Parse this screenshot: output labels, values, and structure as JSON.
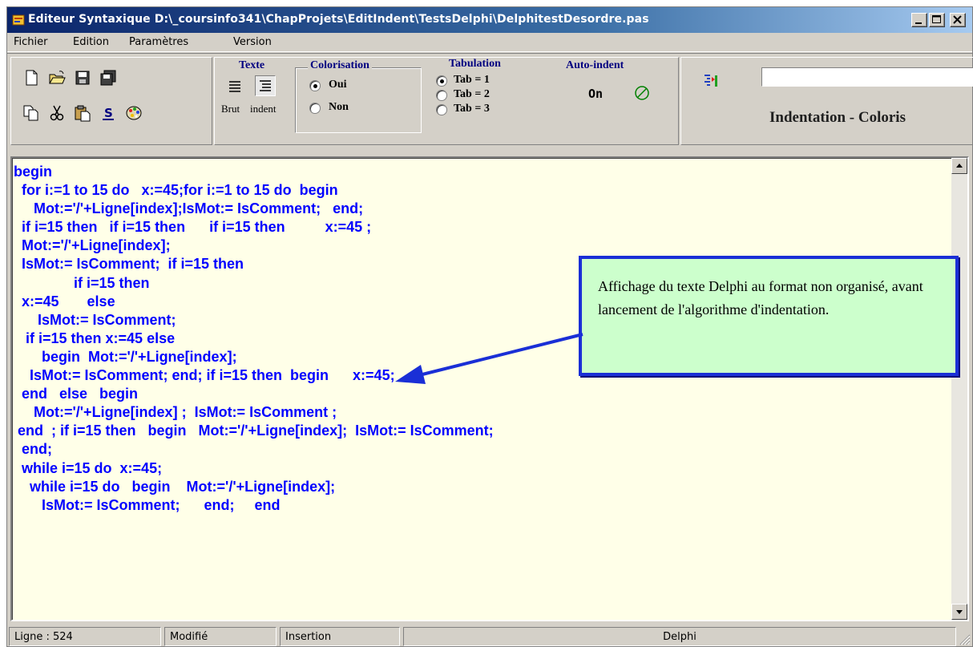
{
  "window": {
    "title": "Editeur Syntaxique D:\\_coursinfo341\\ChapProjets\\EditIndent\\TestsDelphi\\DelphitestDesordre.pas"
  },
  "menu": [
    "Fichier",
    "Edition",
    "Paramètres",
    "Version"
  ],
  "toolbar": {
    "file_icons": [
      "new-file-icon",
      "open-folder-icon",
      "save-icon",
      "save-all-icon"
    ],
    "edit_icons": [
      "copy-icon",
      "cut-icon",
      "paste-icon",
      "underline-s-icon",
      "palette-icon"
    ],
    "texte": {
      "title": "Texte",
      "brut": "Brut",
      "indent": "indent"
    },
    "colorisation": {
      "title": "Colorisation",
      "oui": "Oui",
      "non": "Non",
      "selected": "Oui"
    },
    "tabulation": {
      "title": "Tabulation",
      "options": [
        "Tab = 1",
        "Tab = 2",
        "Tab = 3"
      ],
      "selected": "Tab = 1"
    },
    "autoindent": {
      "title": "Auto-indent",
      "state": "On"
    },
    "right_label": "Indentation - Coloris"
  },
  "editor": {
    "code_color": "#0000ff",
    "background": "#ffffe8",
    "lines": [
      "begin",
      "  for i:=1 to 15 do   x:=45;for i:=1 to 15 do  begin",
      "     Mot:='/'+Ligne[index];IsMot:= IsComment;   end;",
      "  if i=15 then   if i=15 then      if i=15 then          x:=45 ;",
      "  Mot:='/'+Ligne[index];",
      "  IsMot:= IsComment;  if i=15 then",
      "               if i=15 then",
      "  x:=45       else",
      "      IsMot:= IsComment;",
      "   if i=15 then x:=45 else",
      "       begin  Mot:='/'+Ligne[index];",
      "    IsMot:= IsComment; end; if i=15 then  begin      x:=45;",
      "  end   else   begin",
      "     Mot:='/'+Ligne[index] ;  IsMot:= IsComment ;",
      " end  ; if i=15 then   begin   Mot:='/'+Ligne[index];  IsMot:= IsComment;",
      "  end;",
      "  while i=15 do  x:=45;",
      "    while i=15 do   begin    Mot:='/'+Ligne[index];",
      "       IsMot:= IsComment;      end;     end"
    ]
  },
  "callout": {
    "text": "Affichage du texte Delphi au format non organisé, avant lancement de l'algorithme d'indentation."
  },
  "status": {
    "line": "Ligne : 524",
    "modified": "Modifié",
    "mode": "Insertion",
    "language": "Delphi"
  }
}
